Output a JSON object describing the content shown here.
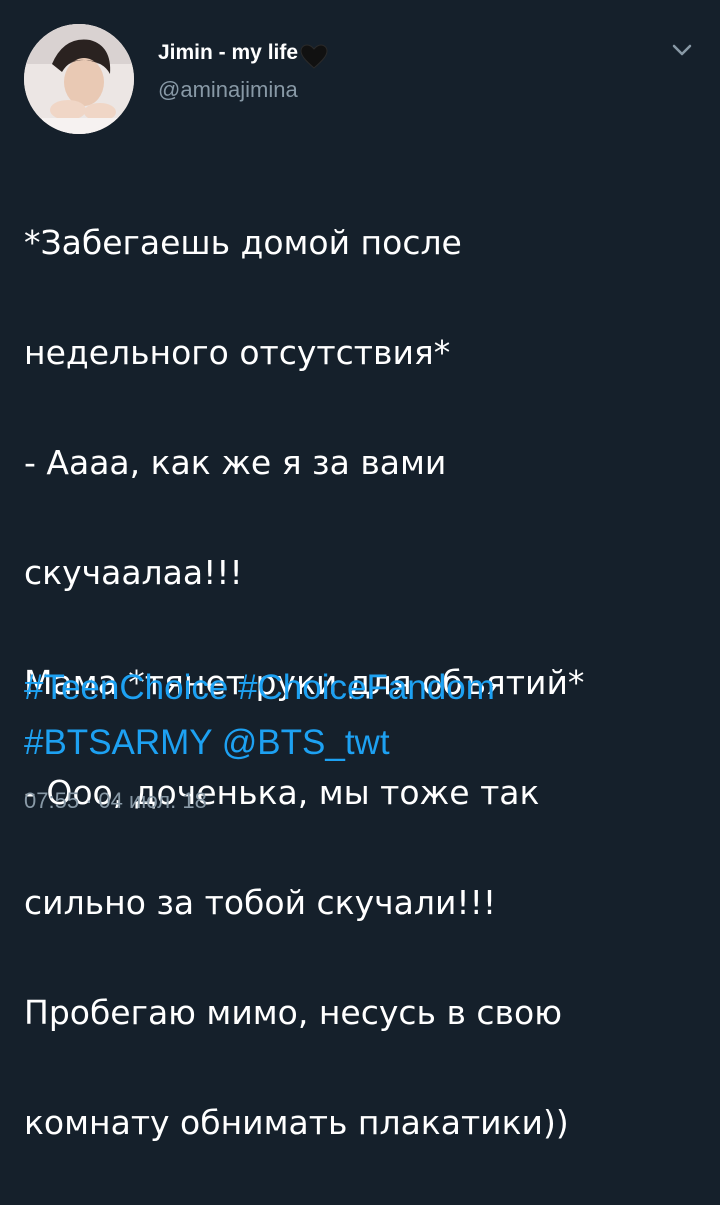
{
  "user": {
    "display_name": "Jimin - my life",
    "name_emoji": "black-heart-icon",
    "handle": "@aminajimina"
  },
  "tweet": {
    "lines": [
      "*Забегаешь домой после",
      "недельного отсутствия*",
      "- Аааа, как же я за вами",
      "скучаалаа!!!",
      "Мама *тянет руки для объятий*",
      "- Ооо, доченька, мы тоже так",
      "сильно за тобой скучали!!!",
      "Пробегаю мимо, несусь в свою",
      "комнату обнимать плакатики))"
    ],
    "hashtags": {
      "tag1": "#TeenChoice",
      "tag2": "#ChoiceFandom",
      "tag3": "#BTSARMY",
      "mention": "@BTS_twt"
    },
    "time": "07:55",
    "separator": "·",
    "date": "04 июл. 18"
  },
  "colors": {
    "background": "#15202b",
    "text": "#ffffff",
    "secondary": "#8899a6",
    "link": "#1da1f2"
  },
  "icons": {
    "menu": "chevron-down-icon"
  }
}
